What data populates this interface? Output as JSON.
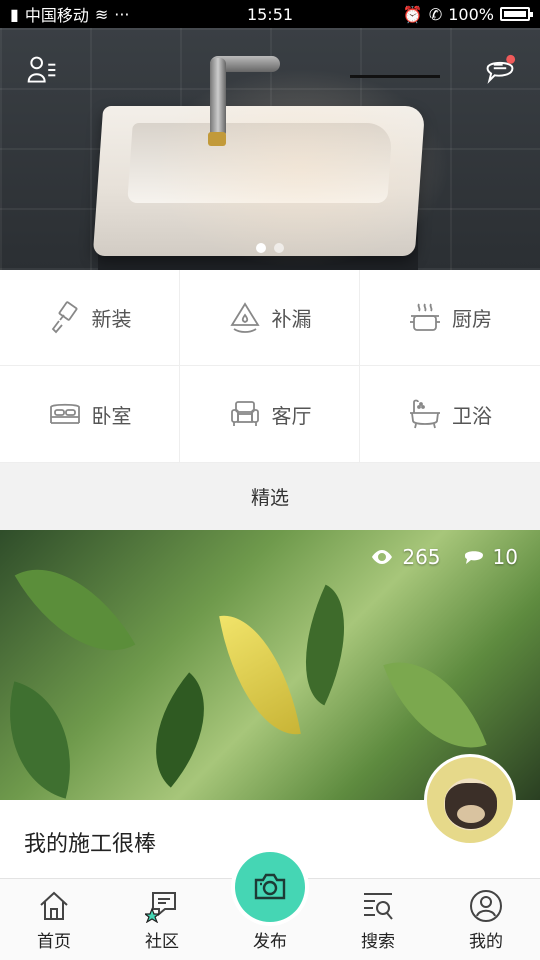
{
  "status_bar": {
    "carrier": "中国移动",
    "time": "15:51",
    "battery": "100%"
  },
  "banner": {
    "page_count": 2,
    "active_index": 0
  },
  "categories": [
    {
      "label": "新装",
      "icon": "paint-roller-icon"
    },
    {
      "label": "补漏",
      "icon": "water-drop-icon"
    },
    {
      "label": "厨房",
      "icon": "cooking-pot-icon"
    },
    {
      "label": "卧室",
      "icon": "bed-icon"
    },
    {
      "label": "客厅",
      "icon": "sofa-icon"
    },
    {
      "label": "卫浴",
      "icon": "bathtub-icon"
    }
  ],
  "section": {
    "title": "精选"
  },
  "feed": {
    "card": {
      "views": "265",
      "comments": "10",
      "title": "我的施工很棒"
    }
  },
  "nav": {
    "items": [
      {
        "label": "首页",
        "icon": "home-icon"
      },
      {
        "label": "社区",
        "icon": "community-chat-icon"
      },
      {
        "label": "发布",
        "icon": "camera-icon"
      },
      {
        "label": "搜索",
        "icon": "search-list-icon"
      },
      {
        "label": "我的",
        "icon": "profile-icon"
      }
    ]
  },
  "colors": {
    "accent": "#45d6b4",
    "notification": "#f05a5a"
  }
}
